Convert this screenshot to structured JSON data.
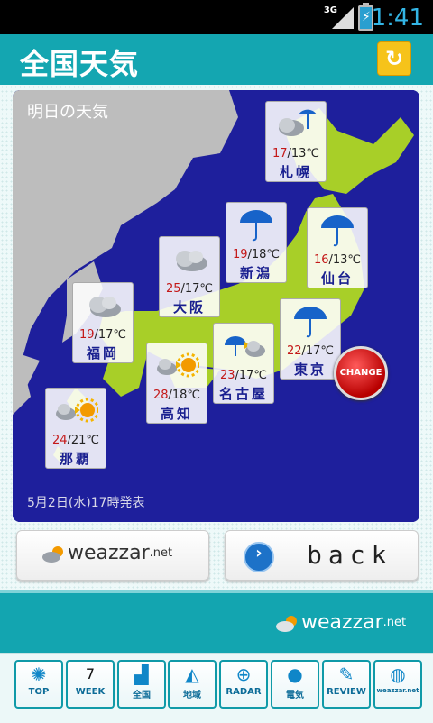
{
  "status": {
    "network": "3G",
    "time": "1:41"
  },
  "header": {
    "title": "全国天気"
  },
  "map": {
    "title": "明日の天気",
    "footer": "5月2日(水)17時発表",
    "change_label": "CHANGE",
    "cities": [
      {
        "name": "札幌",
        "high": "17",
        "low": "13℃",
        "icon": "cloud-rain-icon"
      },
      {
        "name": "新潟",
        "high": "19",
        "low": "18℃",
        "icon": "umbrella-icon"
      },
      {
        "name": "仙台",
        "high": "16",
        "low": "13℃",
        "icon": "umbrella-icon"
      },
      {
        "name": "大阪",
        "high": "25",
        "low": "17℃",
        "icon": "cloud-icon"
      },
      {
        "name": "福岡",
        "high": "19",
        "low": "17℃",
        "icon": "cloud-icon"
      },
      {
        "name": "東京",
        "high": "22",
        "low": "17℃",
        "icon": "umbrella-icon"
      },
      {
        "name": "名古屋",
        "high": "23",
        "low": "17℃",
        "icon": "rain-then-cloud-icon"
      },
      {
        "name": "高知",
        "high": "28",
        "low": "18℃",
        "icon": "cloud-then-sun-icon"
      },
      {
        "name": "那覇",
        "high": "24",
        "low": "21℃",
        "icon": "cloud-then-sun-icon"
      }
    ]
  },
  "buttons": {
    "weazzar_logo": "weazzar",
    "weazzar_suffix": ".net",
    "back": "back"
  },
  "footer": {
    "logo": "weazzar",
    "logo_suffix": ".net"
  },
  "nav": [
    {
      "label": "TOP",
      "icon": "sun-icon",
      "glyph": "✺"
    },
    {
      "label": "WEEK",
      "icon": "calendar-icon",
      "glyph": "7"
    },
    {
      "label": "全国",
      "icon": "japan-icon",
      "glyph": "▟"
    },
    {
      "label": "地域",
      "icon": "region-icon",
      "glyph": "◭"
    },
    {
      "label": "RADAR",
      "icon": "radar-icon",
      "glyph": "⊕"
    },
    {
      "label": "電気",
      "icon": "bulb-icon",
      "glyph": "●"
    },
    {
      "label": "REVIEW",
      "icon": "pencil-icon",
      "glyph": "✎"
    },
    {
      "label": "weazzar.net",
      "icon": "globe-icon",
      "glyph": "◍"
    }
  ]
}
